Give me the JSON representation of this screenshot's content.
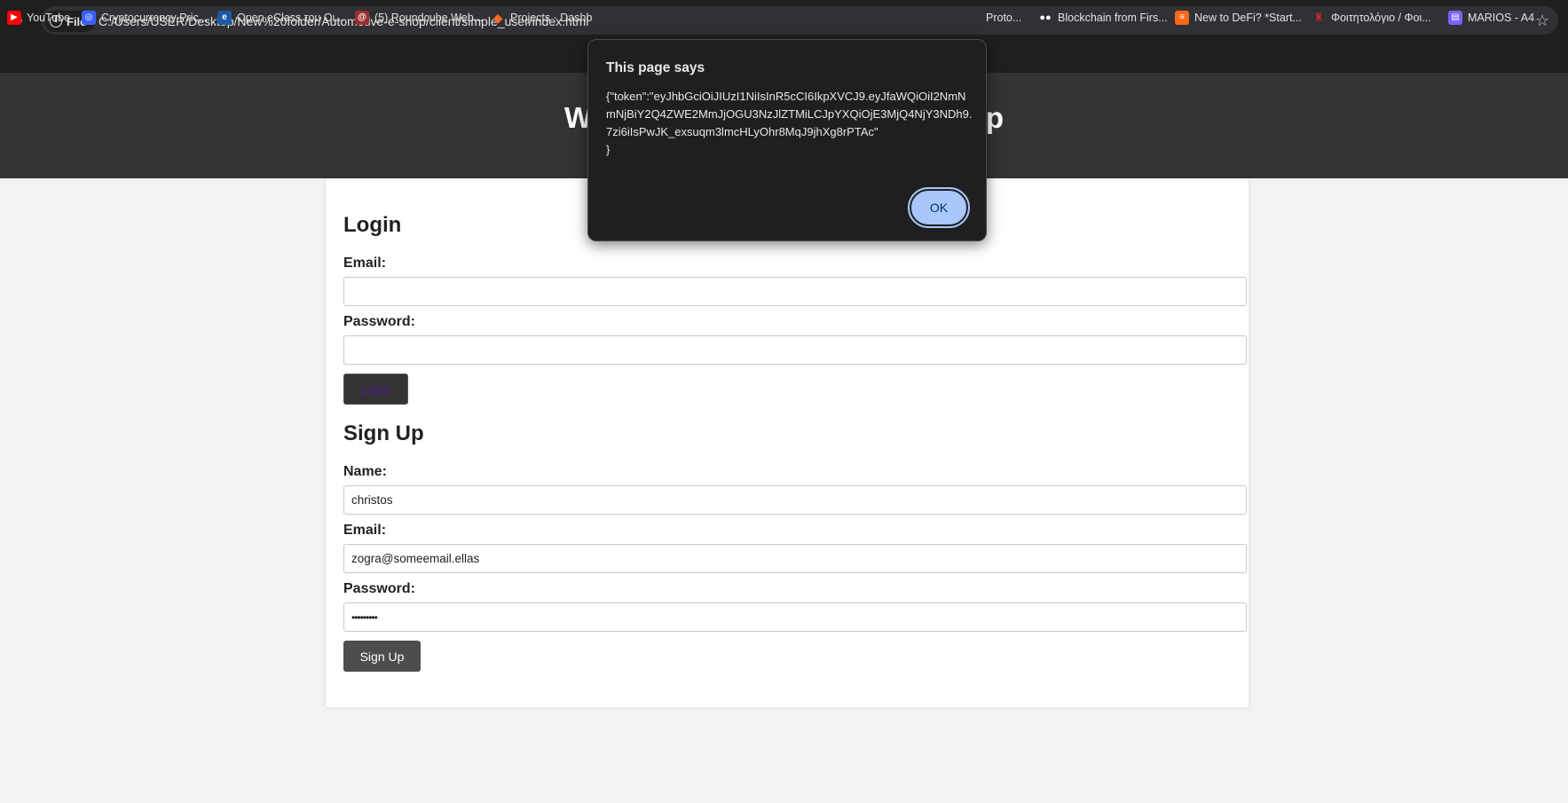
{
  "browser": {
    "file_chip_label": "File",
    "url": "C:/Users/USER/Desktop/New%20folder/Automotive-e-shop/client/simple_user/index.html"
  },
  "bookmarks": [
    {
      "label": "YouTube",
      "color": "#ff0000"
    },
    {
      "label": "Cryptocurrency Pric...",
      "color": "#3861fb"
    },
    {
      "label": "Open eClass του Οι...",
      "color": "#1c5aa6"
    },
    {
      "label": "(5) Roundcube Web...",
      "color": "#9a2f2f"
    },
    {
      "label": "Projects · Dashb",
      "color": "#fc6d26"
    },
    {
      "label": "Proto...",
      "color": "#1f1f1f"
    },
    {
      "label": "Blockchain from Firs...",
      "color": "#ffffff"
    },
    {
      "label": "New to DeFi? *Start...",
      "color": "#ff6719"
    },
    {
      "label": "Φοιτητολόγιο / Φοι...",
      "color": "#c62828"
    },
    {
      "label": "MARIOS - A4",
      "color": "#7b61ff"
    }
  ],
  "page": {
    "title": "Welcome to Automotive e-Shop",
    "login": {
      "heading": "Login",
      "email_label": "Email:",
      "email_value": "",
      "password_label": "Password:",
      "password_value": "",
      "button_label": "Login"
    },
    "signup": {
      "heading": "Sign Up",
      "name_label": "Name:",
      "name_value": "christos",
      "email_label": "Email:",
      "email_value": "zogra@someemail.ellas",
      "password_label": "Password:",
      "password_value": "•••••••••",
      "button_label": "Sign Up"
    }
  },
  "dialog": {
    "title": "This page says",
    "message": "{\"token\":\"eyJhbGciOiJIUzI1NiIsInR5cCI6IkpXVCJ9.eyJfaWQiOiI2NmNmNjBiY2Q4ZWE2MmJjOGU3NzJlZTMiLCJpYXQiOjE3MjQ4NjY3NDh9.7zi6iIsPwJK_exsuqm3lmcHLyOhr8MqJ9jhXg8rPTAc\"\n}",
    "ok_label": "OK"
  }
}
